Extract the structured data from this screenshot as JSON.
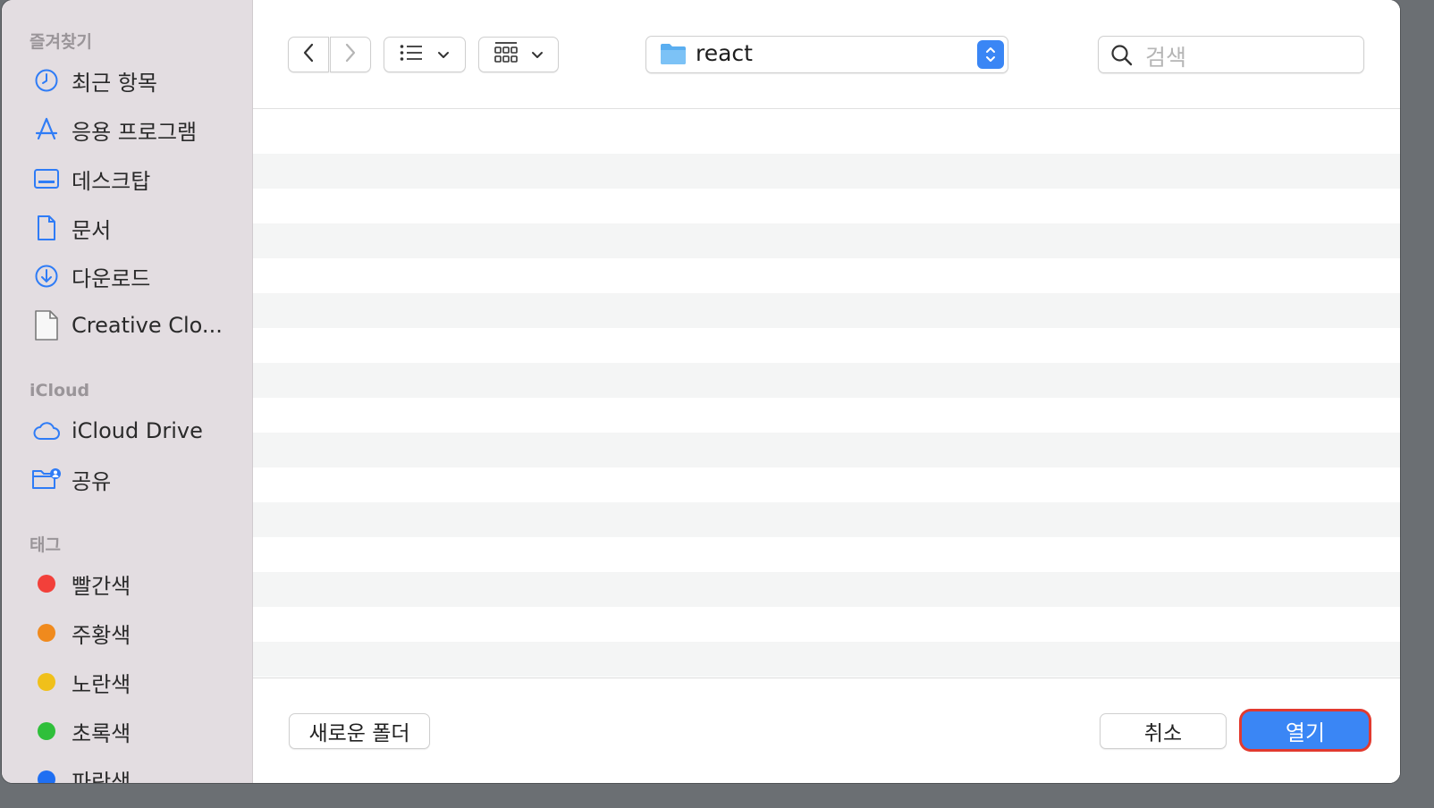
{
  "sidebar": {
    "favorites_heading": "즐겨찾기",
    "favorites": [
      {
        "label": "최근 항목",
        "icon": "clock-icon"
      },
      {
        "label": "응용 프로그램",
        "icon": "app-store-icon"
      },
      {
        "label": "데스크탑",
        "icon": "desktop-icon"
      },
      {
        "label": "문서",
        "icon": "document-icon"
      },
      {
        "label": "다운로드",
        "icon": "download-icon"
      },
      {
        "label": "Creative Clo...",
        "icon": "file-icon"
      }
    ],
    "icloud_heading": "iCloud",
    "icloud": [
      {
        "label": "iCloud Drive",
        "icon": "cloud-icon"
      },
      {
        "label": "공유",
        "icon": "shared-folder-icon"
      }
    ],
    "tags_heading": "태그",
    "tags": [
      {
        "label": "빨간색",
        "color": "#f2403a"
      },
      {
        "label": "주황색",
        "color": "#f08a1d"
      },
      {
        "label": "노란색",
        "color": "#f0c01a"
      },
      {
        "label": "초록색",
        "color": "#2fbf3a"
      },
      {
        "label": "파란색",
        "color": "#1f6ff2"
      }
    ]
  },
  "toolbar": {
    "path_label": "react",
    "search_placeholder": "검색"
  },
  "footer": {
    "new_folder_label": "새로운 폴더",
    "cancel_label": "취소",
    "open_label": "열기"
  },
  "colors": {
    "accent": "#3a86f5",
    "highlight_ring": "#e23a2f"
  }
}
